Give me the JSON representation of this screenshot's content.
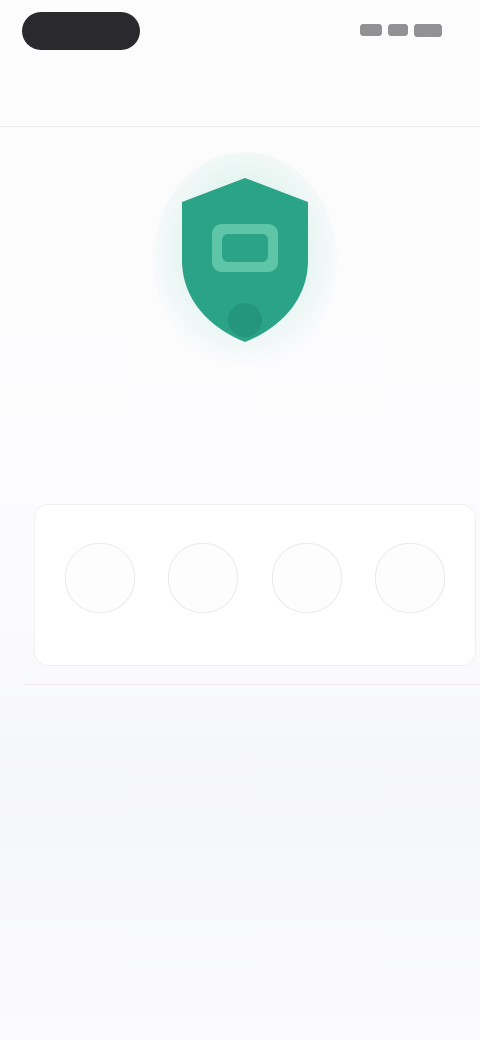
{
  "status_bar": {
    "time": "",
    "icons": [
      "signal-icon",
      "wifi-icon",
      "battery-icon"
    ]
  },
  "nav": {
    "title": "",
    "right_action": ""
  },
  "hero": {
    "icon": "shield-lock-icon",
    "color": "#2aa387",
    "glow_color": "#bfe9dc"
  },
  "main": {
    "heading": "",
    "pin_slots": [
      "",
      "",
      "",
      ""
    ]
  },
  "resend": {
    "prompt": "",
    "link": ""
  },
  "footer": {
    "prompt": "",
    "link": ""
  },
  "colors": {
    "background": "#fbfafc",
    "text_primary": "#3c3c42",
    "text_muted": "#8b8b93",
    "accent": "#2aa387"
  }
}
